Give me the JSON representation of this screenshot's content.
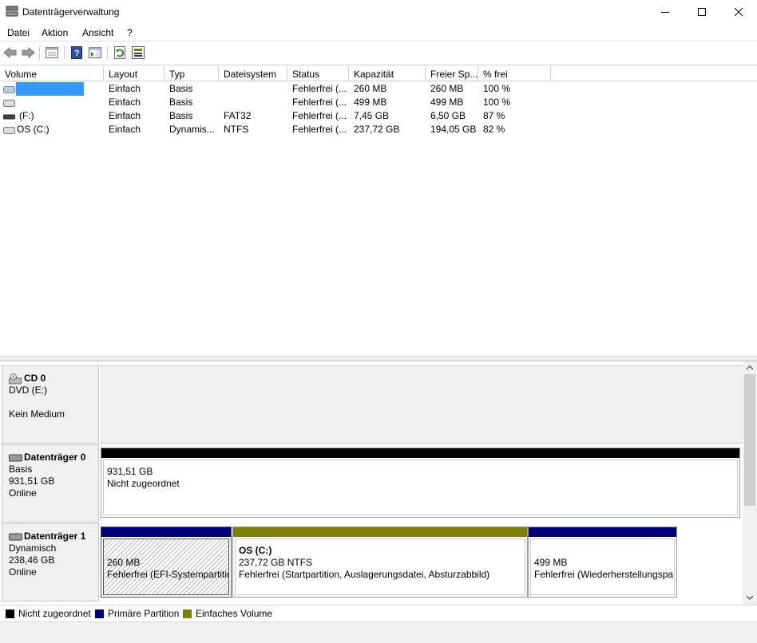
{
  "window": {
    "title": "Datenträgerverwaltung"
  },
  "menu": [
    "Datei",
    "Aktion",
    "Ansicht",
    "?"
  ],
  "toolbar": [
    "back-icon",
    "forward-icon",
    "properties-icon",
    "help-icon",
    "action-pane-icon",
    "refresh-icon",
    "rescan-icon"
  ],
  "columns": [
    "Volume",
    "Layout",
    "Typ",
    "Dateisystem",
    "Status",
    "Kapazität",
    "Freier Sp...",
    "% frei"
  ],
  "volumes": [
    {
      "volume": "",
      "layout": "Einfach",
      "typ": "Basis",
      "fs": "",
      "status": "Fehlerfrei (...",
      "kap": "260 MB",
      "frei": "260 MB",
      "pct": "100 %",
      "selected": true
    },
    {
      "volume": "",
      "layout": "Einfach",
      "typ": "Basis",
      "fs": "",
      "status": "Fehlerfrei (...",
      "kap": "499 MB",
      "frei": "499 MB",
      "pct": "100 %"
    },
    {
      "volume": "(F:)",
      "layout": "Einfach",
      "typ": "Basis",
      "fs": "FAT32",
      "status": "Fehlerfrei (...",
      "kap": "7,45 GB",
      "frei": "6,50 GB",
      "pct": "87 %"
    },
    {
      "volume": "OS (C:)",
      "layout": "Einfach",
      "typ": "Dynamis...",
      "fs": "NTFS",
      "status": "Fehlerfrei (...",
      "kap": "237,72 GB",
      "frei": "194,05 GB",
      "pct": "82 %"
    }
  ],
  "disks": {
    "cd0": {
      "name": "CD 0",
      "line1": "DVD (E:)",
      "line3": "Kein Medium"
    },
    "disk0": {
      "name": "Datenträger 0",
      "line1": "Basis",
      "line2": "931,51 GB",
      "line3": "Online",
      "partitions": [
        {
          "size": "931,51 GB",
          "status": "Nicht zugeordnet"
        }
      ]
    },
    "disk1": {
      "name": "Datenträger 1",
      "line1": "Dynamisch",
      "line2": "238,46 GB",
      "line3": "Online",
      "partitions": [
        {
          "title": "",
          "size": "260 MB",
          "status": "Fehlerfrei (EFI-Systempartitic"
        },
        {
          "title": "OS  (C:)",
          "size": "237,72 GB NTFS",
          "status": "Fehlerfrei (Startpartition, Auslagerungsdatei, Absturzabbild)"
        },
        {
          "title": "",
          "size": "499 MB",
          "status": "Fehlerfrei (Wiederherstellungspa"
        }
      ]
    }
  },
  "legend": [
    {
      "label": "Nicht zugeordnet",
      "color": "#000000"
    },
    {
      "label": "Primäre Partition",
      "color": "#00007f"
    },
    {
      "label": "Einfaches Volume",
      "color": "#808000"
    }
  ],
  "colors": {
    "unallocated": "#000000",
    "primary": "#00007f",
    "simple": "#808000",
    "selection": "#3399ff"
  }
}
